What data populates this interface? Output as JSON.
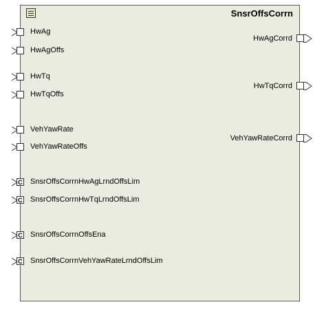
{
  "block": {
    "title": "SnsrOffsCorrn",
    "colors": {
      "fill": "#ebebdf",
      "border": "#5a5a5a"
    }
  },
  "inputs": [
    {
      "label": "HwAg",
      "kind": "data"
    },
    {
      "label": "HwAgOffs",
      "kind": "data"
    },
    {
      "label": "HwTq",
      "kind": "data"
    },
    {
      "label": "HwTqOffs",
      "kind": "data"
    },
    {
      "label": "VehYawRate",
      "kind": "data"
    },
    {
      "label": "VehYawRateOffs",
      "kind": "data"
    },
    {
      "label": "SnsrOffsCorrnHwAgLrndOffsLim",
      "kind": "calibration",
      "marker": "C"
    },
    {
      "label": "SnsrOffsCorrnHwTqLrndOffsLim",
      "kind": "calibration",
      "marker": "C"
    },
    {
      "label": "SnsrOffsCorrnOffsEna",
      "kind": "calibration",
      "marker": "C"
    },
    {
      "label": "SnsrOffsCorrnVehYawRateLrndOffsLim",
      "kind": "calibration",
      "marker": "C"
    }
  ],
  "outputs": [
    {
      "label": "HwAgCorrd"
    },
    {
      "label": "HwTqCorrd"
    },
    {
      "label": "VehYawRateCorrd"
    }
  ]
}
